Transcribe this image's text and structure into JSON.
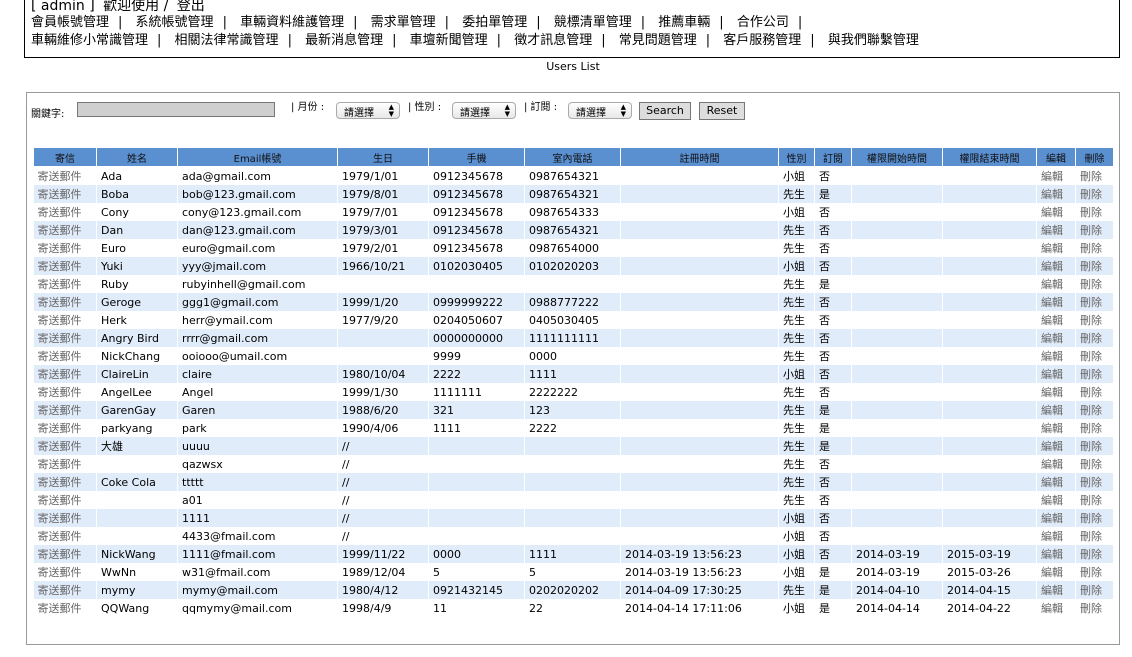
{
  "header": {
    "user": "[ admin ]",
    "welcome": "歡迎使用 /",
    "logout": "登出",
    "nav_row1": [
      "會員帳號管理",
      "系統帳號管理",
      "車輛資料維護管理",
      "需求單管理",
      "委拍單管理",
      "競標清單管理",
      "推薦車輛",
      "合作公司"
    ],
    "nav_row2": [
      "車輛維修小常識管理",
      "相關法律常識管理",
      "最新消息管理",
      "車壇新聞管理",
      "徵才訊息管理",
      "常見問題管理",
      "客戶服務管理",
      "與我們聯繫管理"
    ]
  },
  "page_title": "Users List",
  "filters": {
    "keyword_label": "關鍵字:",
    "keyword_value": "",
    "month_label": "| 月份 :",
    "month_value": "請選擇",
    "gender_label": "| 性別 :",
    "gender_value": "請選擇",
    "subscribe_label": "| 訂閱 :",
    "subscribe_value": "請選擇",
    "search_button": "Search",
    "reset_button": "Reset"
  },
  "table": {
    "columns": [
      "寄信",
      "姓名",
      "Email帳號",
      "生日",
      "手機",
      "室內電話",
      "註冊時間",
      "性別",
      "訂閱",
      "權限開始時間",
      "權限結束時間",
      "編輯",
      "刪除"
    ],
    "rows": [
      [
        "寄送郵件",
        "Ada",
        "ada@gmail.com",
        "1979/1/01",
        "0912345678",
        "0987654321",
        "",
        "小姐",
        "否",
        "",
        "",
        "編輯",
        "刪除"
      ],
      [
        "寄送郵件",
        "Boba",
        "bob@123.gmail.com",
        "1979/8/01",
        "0912345678",
        "0987654321",
        "",
        "先生",
        "是",
        "",
        "",
        "編輯",
        "刪除"
      ],
      [
        "寄送郵件",
        "Cony",
        "cony@123.gmail.com",
        "1979/7/01",
        "0912345678",
        "0987654333",
        "",
        "小姐",
        "否",
        "",
        "",
        "編輯",
        "刪除"
      ],
      [
        "寄送郵件",
        "Dan",
        "dan@123.gmail.com",
        "1979/3/01",
        "0912345678",
        "0987654321",
        "",
        "先生",
        "否",
        "",
        "",
        "編輯",
        "刪除"
      ],
      [
        "寄送郵件",
        "Euro",
        "euro@gmail.com",
        "1979/2/01",
        "0912345678",
        "0987654000",
        "",
        "先生",
        "否",
        "",
        "",
        "編輯",
        "刪除"
      ],
      [
        "寄送郵件",
        "Yuki",
        "yyy@jmail.com",
        "1966/10/21",
        "0102030405",
        "0102020203",
        "",
        "小姐",
        "否",
        "",
        "",
        "編輯",
        "刪除"
      ],
      [
        "寄送郵件",
        "Ruby",
        "rubyinhell@gmail.com",
        "",
        "",
        "",
        "",
        "先生",
        "是",
        "",
        "",
        "編輯",
        "刪除"
      ],
      [
        "寄送郵件",
        "Geroge",
        "ggg1@gmail.com",
        "1999/1/20",
        "0999999222",
        "0988777222",
        "",
        "先生",
        "否",
        "",
        "",
        "編輯",
        "刪除"
      ],
      [
        "寄送郵件",
        "Herk",
        "herr@ymail.com",
        "1977/9/20",
        "0204050607",
        "0405030405",
        "",
        "先生",
        "否",
        "",
        "",
        "編輯",
        "刪除"
      ],
      [
        "寄送郵件",
        "Angry Bird",
        "rrrr@gmail.com",
        "",
        "0000000000",
        "1111111111",
        "",
        "先生",
        "否",
        "",
        "",
        "編輯",
        "刪除"
      ],
      [
        "寄送郵件",
        "NickChang",
        "ooiooo@umail.com",
        "",
        "9999",
        "0000",
        "",
        "先生",
        "否",
        "",
        "",
        "編輯",
        "刪除"
      ],
      [
        "寄送郵件",
        "ClaireLin",
        "claire",
        "1980/10/04",
        "2222",
        "1111",
        "",
        "小姐",
        "否",
        "",
        "",
        "編輯",
        "刪除"
      ],
      [
        "寄送郵件",
        "AngelLee",
        "Angel",
        "1999/1/30",
        "1111111",
        "2222222",
        "",
        "先生",
        "否",
        "",
        "",
        "編輯",
        "刪除"
      ],
      [
        "寄送郵件",
        "GarenGay",
        "Garen",
        "1988/6/20",
        "321",
        "123",
        "",
        "先生",
        "是",
        "",
        "",
        "編輯",
        "刪除"
      ],
      [
        "寄送郵件",
        "parkyang",
        "park",
        "1990/4/06",
        "1111",
        "2222",
        "",
        "先生",
        "是",
        "",
        "",
        "編輯",
        "刪除"
      ],
      [
        "寄送郵件",
        "大雄",
        "uuuu",
        "//",
        "",
        "",
        "",
        "先生",
        "是",
        "",
        "",
        "編輯",
        "刪除"
      ],
      [
        "寄送郵件",
        "",
        "qazwsx",
        "//",
        "",
        "",
        "",
        "先生",
        "否",
        "",
        "",
        "編輯",
        "刪除"
      ],
      [
        "寄送郵件",
        "Coke Cola",
        "ttttt",
        "//",
        "",
        "",
        "",
        "先生",
        "否",
        "",
        "",
        "編輯",
        "刪除"
      ],
      [
        "寄送郵件",
        "",
        "a01",
        "//",
        "",
        "",
        "",
        "先生",
        "否",
        "",
        "",
        "編輯",
        "刪除"
      ],
      [
        "寄送郵件",
        "",
        "1111",
        "//",
        "",
        "",
        "",
        "小姐",
        "否",
        "",
        "",
        "編輯",
        "刪除"
      ],
      [
        "寄送郵件",
        "",
        "4433@fmail.com",
        "//",
        "",
        "",
        "",
        "小姐",
        "否",
        "",
        "",
        "編輯",
        "刪除"
      ],
      [
        "寄送郵件",
        "NickWang",
        "1111@fmail.com",
        "1999/11/22",
        "0000",
        "1111",
        "2014-03-19 13:56:23",
        "小姐",
        "否",
        "2014-03-19",
        "2015-03-19",
        "編輯",
        "刪除"
      ],
      [
        "寄送郵件",
        "WwNn",
        "w31@fmail.com",
        "1989/12/04",
        "5",
        "5",
        "2014-03-19 13:56:23",
        "小姐",
        "是",
        "2014-03-19",
        "2015-03-26",
        "編輯",
        "刪除"
      ],
      [
        "寄送郵件",
        "mymy",
        "mymy@mail.com",
        "1980/4/12",
        "0921432145",
        "0202020202",
        "2014-04-09 17:30:25",
        "先生",
        "是",
        "2014-04-10",
        "2014-04-15",
        "編輯",
        "刪除"
      ],
      [
        "寄送郵件",
        "QQWang",
        "qqmymy@mail.com",
        "1998/4/9",
        "11",
        "22",
        "2014-04-14 17:11:06",
        "小姐",
        "是",
        "2014-04-14",
        "2014-04-22",
        "編輯",
        "刪除"
      ]
    ]
  }
}
